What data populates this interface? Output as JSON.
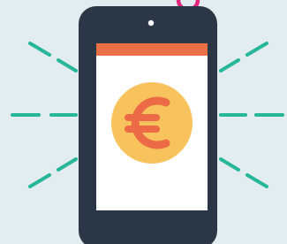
{
  "illustration": {
    "colors": {
      "background": "#e3ecef",
      "phone_body": "#2b3746",
      "screen": "#ffffff",
      "header_bar": "#ec7046",
      "camera": "#ffffff",
      "coin": "#f8c35c",
      "currency_symbol": "#ec6a45",
      "ray": "#26b79b",
      "top_arc": "#e6257f"
    },
    "icons": {
      "currency": "euro-sign-icon",
      "device": "smartphone-icon",
      "rays": "signal-rays-icon"
    }
  }
}
